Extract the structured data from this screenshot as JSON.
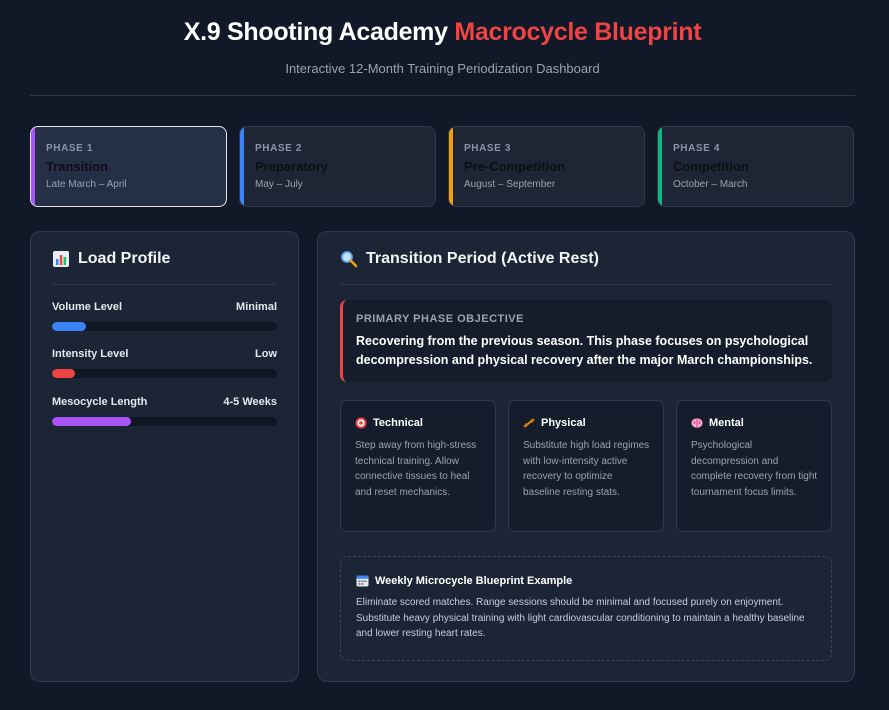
{
  "header": {
    "title_main": "X.9 Shooting Academy",
    "title_accent": "Macrocycle Blueprint",
    "subtitle": "Interactive 12-Month Training Periodization Dashboard"
  },
  "phases": [
    {
      "number": "PHASE 1",
      "name": "Transition",
      "dates": "Late March – April",
      "color": "#a855f7",
      "active": true
    },
    {
      "number": "PHASE 2",
      "name": "Preparatory",
      "dates": "May – July",
      "color": "#3b82f6",
      "active": false
    },
    {
      "number": "PHASE 3",
      "name": "Pre-Competition",
      "dates": "August – September",
      "color": "#f59e0b",
      "active": false
    },
    {
      "number": "PHASE 4",
      "name": "Competition",
      "dates": "October – March",
      "color": "#10b981",
      "active": false
    }
  ],
  "load_profile": {
    "heading": "Load Profile",
    "icon": "bar-chart-icon",
    "metrics": [
      {
        "label": "Volume Level",
        "value": "Minimal",
        "fill_fraction": 0.15,
        "color": "#3b82f6"
      },
      {
        "label": "Intensity Level",
        "value": "Low",
        "fill_fraction": 0.1,
        "color": "#ef4444"
      },
      {
        "label": "Mesocycle Length",
        "value": "4-5 Weeks",
        "fill_fraction": 0.35,
        "color": "#a855f7"
      }
    ]
  },
  "detail": {
    "heading": "Transition Period (Active Rest)",
    "icon": "magnifier-icon",
    "objective_label": "PRIMARY PHASE OBJECTIVE",
    "objective_text": "Recovering from the previous season. This phase focuses on psychological decompression and physical recovery after the major March championships.",
    "cards": [
      {
        "title": "Technical",
        "icon": "target-icon",
        "text": "Step away from high-stress technical training. Allow connective tissues to heal and reset mechanics."
      },
      {
        "title": "Physical",
        "icon": "dumbbell-icon",
        "text": "Substitute high load regimes with low-intensity active recovery to optimize baseline resting stats."
      },
      {
        "title": "Mental",
        "icon": "brain-icon",
        "text": "Psychological decompression and complete recovery from tight tournament focus limits."
      }
    ],
    "microcycle_title": "Weekly Microcycle Blueprint Example",
    "microcycle_icon": "calendar-icon",
    "microcycle_text": "Eliminate scored matches. Range sessions should be minimal and focused purely on enjoyment. Substitute heavy physical training with light cardiovascular conditioning to maintain a healthy baseline and lower resting heart rates."
  },
  "colors": {
    "accent_red": "#ef4444",
    "background": "#111827",
    "panel": "#1c2536"
  }
}
